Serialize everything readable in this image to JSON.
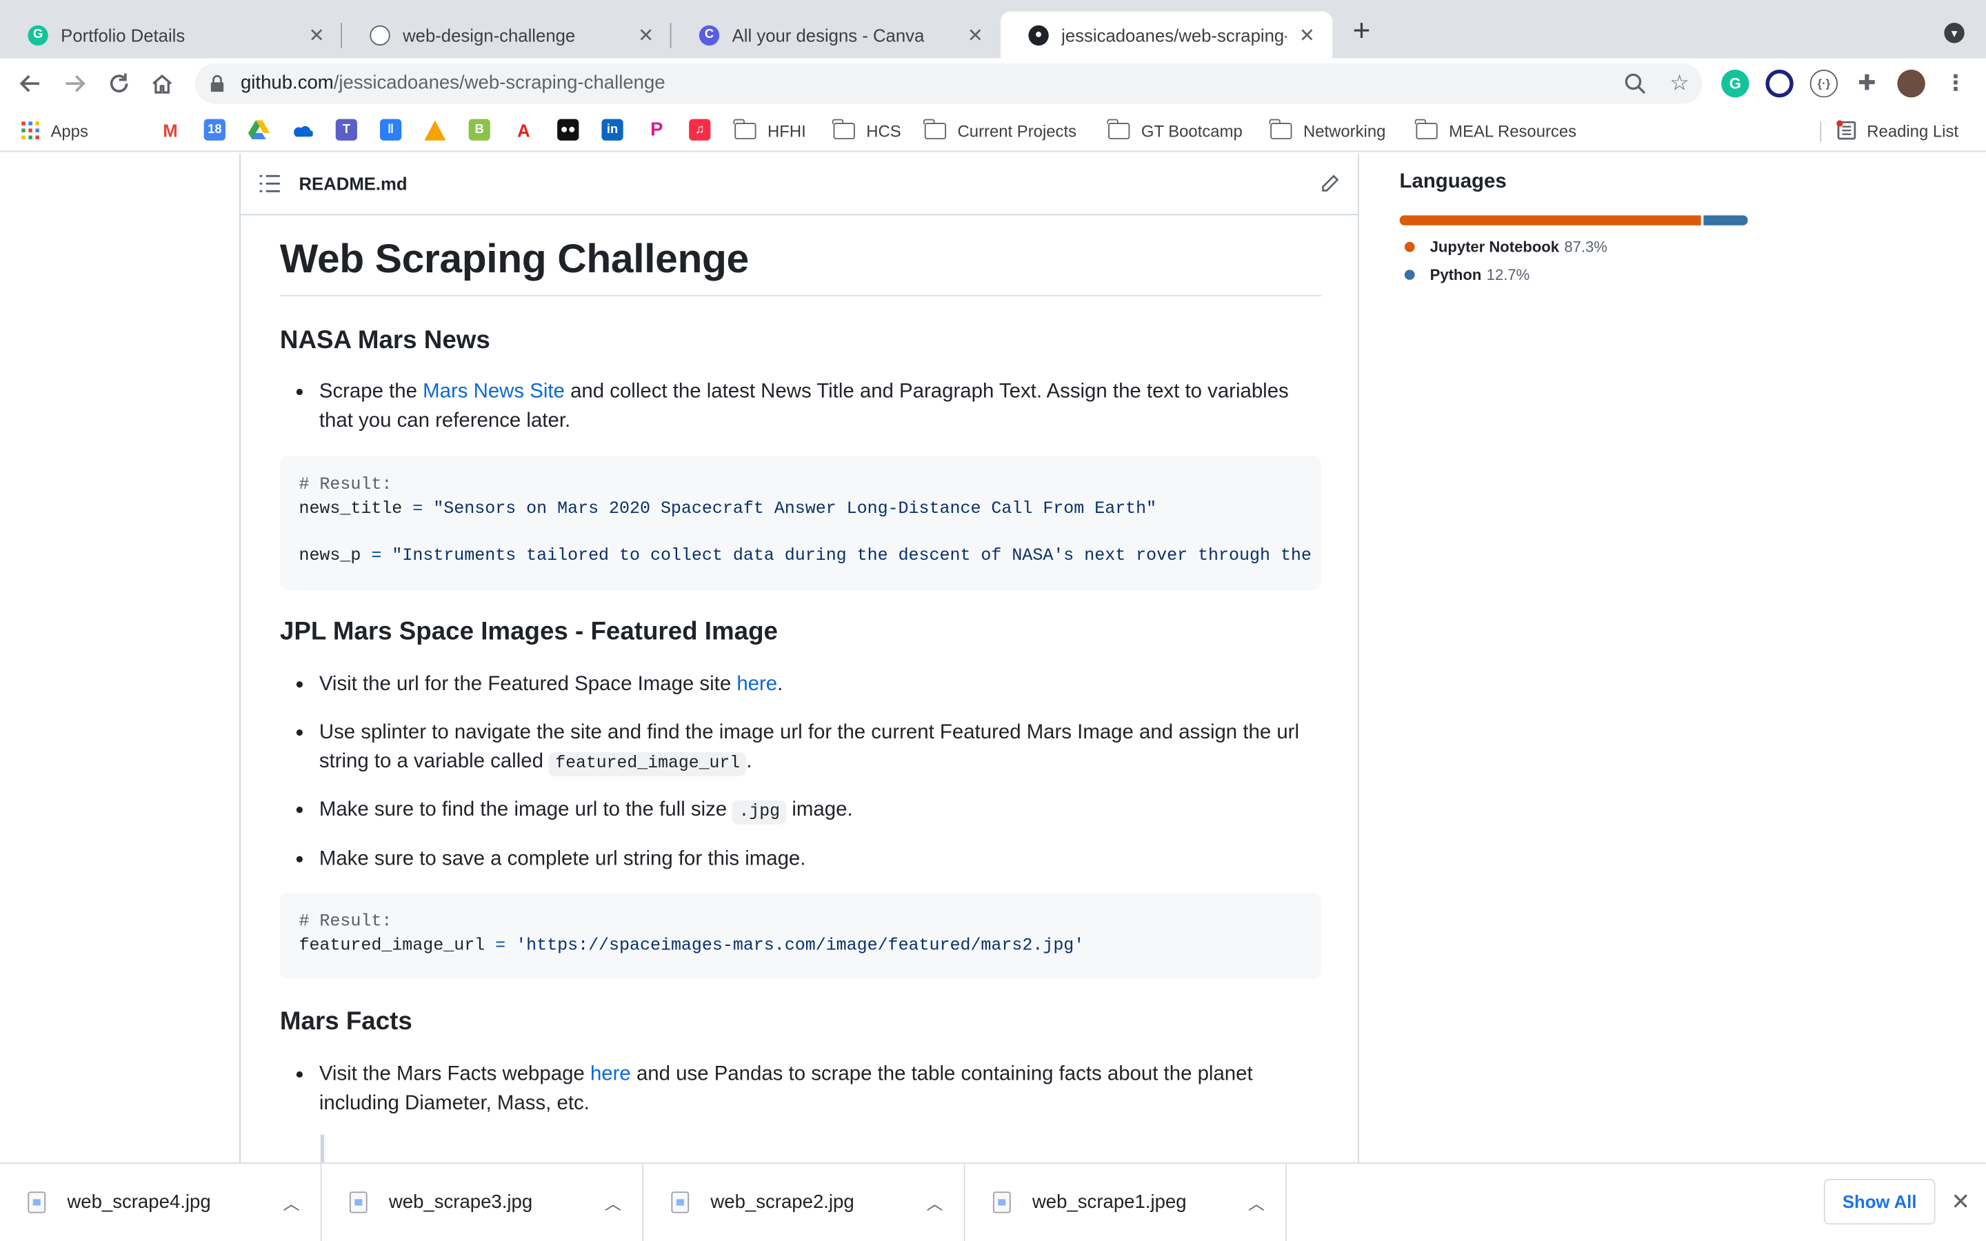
{
  "browser": {
    "tabs": [
      {
        "title": "Portfolio Details",
        "icon": "grammarly-icon",
        "active": false
      },
      {
        "title": "web-design-challenge",
        "icon": "globe-icon",
        "active": false
      },
      {
        "title": "All your designs - Canva",
        "icon": "canva-icon",
        "active": false
      },
      {
        "title": "jessicadoanes/web-scraping-c",
        "icon": "github-icon",
        "active": true
      }
    ],
    "url_host": "github.com",
    "url_path": "/jessicadoanes/web-scraping-challenge",
    "bookmarks": {
      "apps_label": "Apps",
      "folders": [
        "HFHI",
        "HCS",
        "Current Projects",
        "GT Bootcamp",
        "Networking",
        "MEAL Resources"
      ],
      "reading_list": "Reading List"
    }
  },
  "readme": {
    "filename": "README.md",
    "title": "Web Scraping Challenge",
    "sections": {
      "news": {
        "heading": "NASA Mars News",
        "bullet_pre": "Scrape the ",
        "bullet_link": "Mars News Site",
        "bullet_post": " and collect the latest News Title and Paragraph Text. Assign the text to variables that you can reference later.",
        "code_comment": "# Result:",
        "code_var1": "news_title",
        "code_op": "=",
        "code_str1": "\"Sensors on Mars 2020 Spacecraft Answer Long-Distance Call From Earth\"",
        "code_var2": "news_p",
        "code_str2": "\"Instruments tailored to collect data during the descent of NASA's next rover through the Re"
      },
      "jpl": {
        "heading": "JPL Mars Space Images - Featured Image",
        "b1_pre": "Visit the url for the Featured Space Image site ",
        "b1_link": "here",
        "b1_post": ".",
        "b2_pre": "Use splinter to navigate the site and find the image url for the current Featured Mars Image and assign the url string to a variable called ",
        "b2_code": "featured_image_url",
        "b2_post": ".",
        "b3_pre": "Make sure to find the image url to the full size ",
        "b3_code": ".jpg",
        "b3_post": " image.",
        "b4": "Make sure to save a complete url string for this image.",
        "code_comment": "# Result:",
        "code_var": "featured_image_url",
        "code_op": "=",
        "code_str": "'https://spaceimages-mars.com/image/featured/mars2.jpg'"
      },
      "facts": {
        "heading": "Mars Facts",
        "b1_pre": "Visit the Mars Facts webpage ",
        "b1_link": "here",
        "b1_post": " and use Pandas to scrape the table containing facts about the planet including Diameter, Mass, etc."
      }
    }
  },
  "languages": {
    "title": "Languages",
    "items": [
      {
        "name": "Jupyter Notebook",
        "percent": "87.3%",
        "value": 87.3,
        "color": "#DA5B0B"
      },
      {
        "name": "Python",
        "percent": "12.7%",
        "value": 12.7,
        "color": "#3572A5"
      }
    ]
  },
  "downloads": {
    "files": [
      "web_scrape4.jpg",
      "web_scrape3.jpg",
      "web_scrape2.jpg",
      "web_scrape1.jpeg"
    ],
    "show_all": "Show All"
  }
}
